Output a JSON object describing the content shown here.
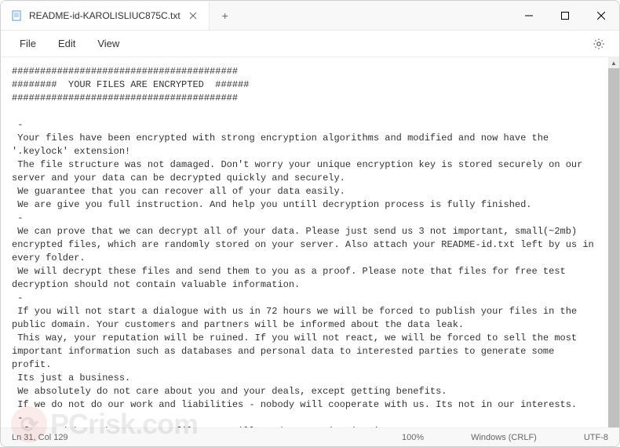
{
  "tab": {
    "title": "README-id-KAROLISLIUC875C.txt"
  },
  "menu": {
    "file": "File",
    "edit": "Edit",
    "view": "View"
  },
  "content": "########################################\n########  YOUR FILES ARE ENCRYPTED  ######\n########################################\n\n -\n Your files have been encrypted with strong encryption algorithms and modified and now have the '.keylock' extension!\n The file structure was not damaged. Don't worry your unique encryption key is stored securely on our server and your data can be decrypted quickly and securely.\n We guarantee that you can recover all of your data easily.\n We are give you full instruction. And help you untill decryption process is fully finished.\n -\n We can prove that we can decrypt all of your data. Please just send us 3 not important, small(~2mb) encrypted files, which are randomly stored on your server. Also attach your README-id.txt left by us in every folder.\n We will decrypt these files and send them to you as a proof. Please note that files for free test decryption should not contain valuable information.\n -\n If you will not start a dialogue with us in 72 hours we will be forced to publish your files in the public domain. Your customers and partners will be informed about the data leak.\n This way, your reputation will be ruined. If you will not react, we will be forced to sell the most important information such as databases and personal data to interested parties to generate some profit.\n Its just a business.\n We absolutely do not care about you and your deals, except getting benefits.\n If we do not do our work and liabilities - nobody will cooperate with us. Its not in our interests.\n -\n If you wish to decrypt your files you will need to pay in Bitcoins.",
  "status": {
    "position": "Ln 31, Col 129",
    "zoom": "100%",
    "line_ending": "Windows (CRLF)",
    "encoding": "UTF-8"
  },
  "watermark": {
    "text": "PCrisk.com"
  }
}
